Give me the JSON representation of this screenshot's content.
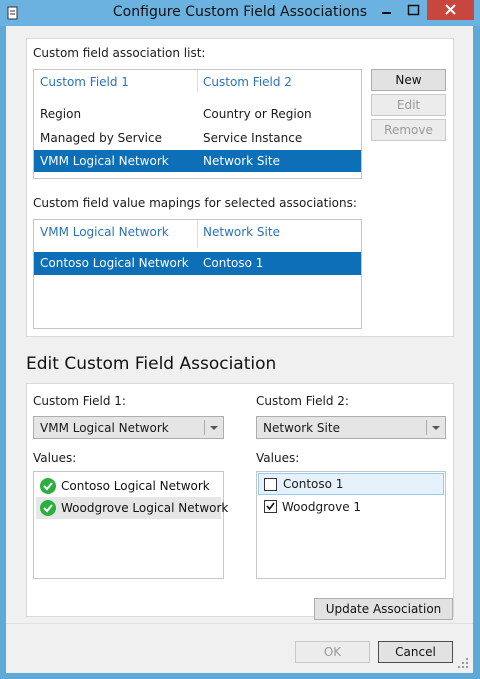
{
  "window": {
    "title": "Configure Custom Field Associations"
  },
  "associations": {
    "label": "Custom field association list:",
    "headers": [
      "Custom Field 1",
      "Custom Field 2"
    ],
    "rows": [
      [
        "Region",
        "Country or Region"
      ],
      [
        "Managed by Service",
        "Service Instance"
      ],
      [
        "VMM Logical Network",
        "Network Site"
      ]
    ],
    "selected_row": 2,
    "buttons": {
      "new": "New",
      "edit": "Edit",
      "remove": "Remove"
    }
  },
  "mappings": {
    "label": "Custom field value mapings for selected associations:",
    "headers": [
      "VMM Logical Network",
      "Network Site"
    ],
    "rows": [
      [
        "Contoso Logical Network",
        "Contoso 1"
      ]
    ]
  },
  "edit": {
    "title": "Edit Custom Field Association",
    "field1": {
      "label": "Custom Field 1:",
      "value": "VMM Logical Network",
      "values_label": "Values:",
      "values": [
        "Contoso Logical Network",
        "Woodgrove Logical Network"
      ]
    },
    "field2": {
      "label": "Custom Field 2:",
      "value": "Network Site",
      "values_label": "Values:",
      "values": [
        {
          "label": "Contoso 1",
          "checked": false
        },
        {
          "label": "Woodgrove 1",
          "checked": true
        }
      ]
    },
    "update_label": "Update Association"
  },
  "footer": {
    "ok": "OK",
    "cancel": "Cancel"
  },
  "colors": {
    "selection": "#0d6fb8",
    "header_link": "#2a73b8",
    "titlebar": "#6cb2e1",
    "close": "#c7463d",
    "check_green": "#2bb03f"
  }
}
